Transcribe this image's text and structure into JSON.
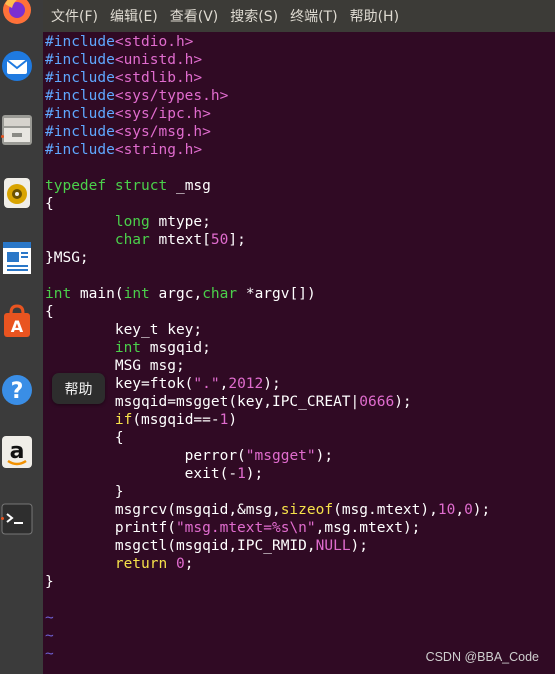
{
  "menubar": {
    "items": [
      "文件(F)",
      "编辑(E)",
      "查看(V)",
      "搜索(S)",
      "终端(T)",
      "帮助(H)"
    ]
  },
  "dock": {
    "items": [
      {
        "name": "firefox-icon"
      },
      {
        "name": "thunderbird-icon"
      },
      {
        "name": "files-icon"
      },
      {
        "name": "rhythmbox-icon"
      },
      {
        "name": "libreoffice-writer-icon"
      },
      {
        "name": "software-center-icon"
      },
      {
        "name": "help-icon"
      },
      {
        "name": "amazon-icon"
      },
      {
        "name": "terminal-icon"
      }
    ]
  },
  "tooltip": {
    "text": "帮助"
  },
  "code": {
    "lines": [
      [
        {
          "t": "#include",
          "c": "prep"
        },
        {
          "t": "<stdio.h>",
          "c": "str"
        }
      ],
      [
        {
          "t": "#include",
          "c": "prep"
        },
        {
          "t": "<unistd.h>",
          "c": "str"
        }
      ],
      [
        {
          "t": "#include",
          "c": "prep"
        },
        {
          "t": "<stdlib.h>",
          "c": "str"
        }
      ],
      [
        {
          "t": "#include",
          "c": "prep"
        },
        {
          "t": "<sys/types.h>",
          "c": "str"
        }
      ],
      [
        {
          "t": "#include",
          "c": "prep"
        },
        {
          "t": "<sys/ipc.h>",
          "c": "str"
        }
      ],
      [
        {
          "t": "#include",
          "c": "prep"
        },
        {
          "t": "<sys/msg.h>",
          "c": "str"
        }
      ],
      [
        {
          "t": "#include",
          "c": "prep"
        },
        {
          "t": "<string.h>",
          "c": "str"
        }
      ],
      [],
      [
        {
          "t": "typedef",
          "c": "kw"
        },
        {
          "t": " "
        },
        {
          "t": "struct",
          "c": "kw"
        },
        {
          "t": " _msg"
        }
      ],
      [
        {
          "t": "{"
        }
      ],
      [
        {
          "t": "        "
        },
        {
          "t": "long",
          "c": "kw"
        },
        {
          "t": " mtype;"
        }
      ],
      [
        {
          "t": "        "
        },
        {
          "t": "char",
          "c": "kw"
        },
        {
          "t": " mtext["
        },
        {
          "t": "50",
          "c": "str"
        },
        {
          "t": "];"
        }
      ],
      [
        {
          "t": "}MSG;"
        }
      ],
      [],
      [
        {
          "t": "int",
          "c": "kw"
        },
        {
          "t": " main("
        },
        {
          "t": "int",
          "c": "kw"
        },
        {
          "t": " argc,"
        },
        {
          "t": "char",
          "c": "kw"
        },
        {
          "t": " *argv[])"
        }
      ],
      [
        {
          "t": "{"
        }
      ],
      [
        {
          "t": "        key_t key;"
        }
      ],
      [
        {
          "t": "        "
        },
        {
          "t": "int",
          "c": "kw"
        },
        {
          "t": " msgqid;"
        }
      ],
      [
        {
          "t": "        MSG msg;"
        }
      ],
      [
        {
          "t": "        key=ftok("
        },
        {
          "t": "\".\"",
          "c": "str"
        },
        {
          "t": ","
        },
        {
          "t": "2012",
          "c": "str"
        },
        {
          "t": ");"
        }
      ],
      [
        {
          "t": "        msgqid=msgget(key,IPC_CREAT|"
        },
        {
          "t": "0666",
          "c": "str"
        },
        {
          "t": ");"
        }
      ],
      [
        {
          "t": "        "
        },
        {
          "t": "if",
          "c": "ctl"
        },
        {
          "t": "(msgqid==-"
        },
        {
          "t": "1",
          "c": "str"
        },
        {
          "t": ")"
        }
      ],
      [
        {
          "t": "        {"
        }
      ],
      [
        {
          "t": "                perror("
        },
        {
          "t": "\"msgget\"",
          "c": "str"
        },
        {
          "t": ");"
        }
      ],
      [
        {
          "t": "                exit(-"
        },
        {
          "t": "1",
          "c": "str"
        },
        {
          "t": ");"
        }
      ],
      [
        {
          "t": "        }"
        }
      ],
      [
        {
          "t": "        msgrcv(msgqid,&msg,"
        },
        {
          "t": "sizeof",
          "c": "ctl"
        },
        {
          "t": "(msg.mtext),"
        },
        {
          "t": "10",
          "c": "str"
        },
        {
          "t": ","
        },
        {
          "t": "0",
          "c": "str"
        },
        {
          "t": ");"
        }
      ],
      [
        {
          "t": "        printf("
        },
        {
          "t": "\"msg.mtext=%s\\n\"",
          "c": "str"
        },
        {
          "t": ",msg.mtext);"
        }
      ],
      [
        {
          "t": "        msgctl(msgqid,IPC_RMID,"
        },
        {
          "t": "NULL",
          "c": "str"
        },
        {
          "t": ");"
        }
      ],
      [
        {
          "t": "        "
        },
        {
          "t": "return",
          "c": "ctl"
        },
        {
          "t": " "
        },
        {
          "t": "0",
          "c": "str"
        },
        {
          "t": ";"
        }
      ],
      [
        {
          "t": "}"
        }
      ],
      [],
      [
        {
          "t": "~",
          "c": "tilde"
        }
      ],
      [
        {
          "t": "~",
          "c": "tilde"
        }
      ],
      [
        {
          "t": "~",
          "c": "tilde"
        }
      ]
    ]
  },
  "watermark": "CSDN @BBA_Code",
  "colors": {
    "terminal_bg": "#300a24",
    "menubar_bg": "#3c3b37",
    "dock_bg": "#3b3b3b"
  }
}
